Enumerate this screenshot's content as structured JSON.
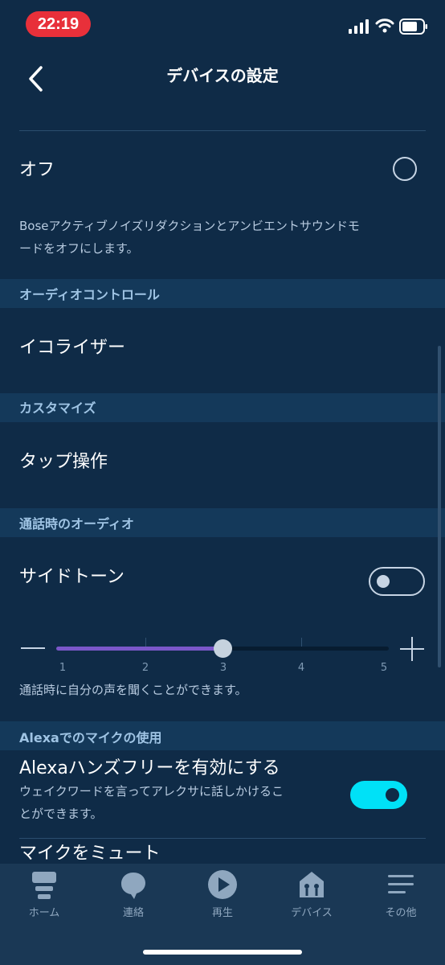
{
  "status": {
    "time": "22:19"
  },
  "nav": {
    "title": "デバイスの設定",
    "back_icon": "chevron-left-icon"
  },
  "off_option": {
    "label": "オフ",
    "description_line1": "Boseアクティブノイズリダクションとアンビエントサウンドモ",
    "description_line2": "ードをオフにします。"
  },
  "sections": {
    "audio_control": "オーディオコントロール",
    "customize": "カスタマイズ",
    "call_audio": "通話時のオーディオ",
    "alexa_mic": "Alexaでのマイクの使用"
  },
  "equalizer_label": "イコライザー",
  "tap_label": "タップ操作",
  "sidetone": {
    "label": "サイドトーン",
    "enabled": false,
    "slider_value": 3,
    "slider_min": 1,
    "slider_max": 5,
    "ticks": [
      "1",
      "2",
      "3",
      "4",
      "5"
    ],
    "description": "通話時に自分の声を聞くことができます。"
  },
  "alexa_handsfree": {
    "label": "Alexaハンズフリーを有効にする",
    "description_line1": "ウェイクワードを言ってアレクサに話しかけるこ",
    "description_line2": "とができます。",
    "enabled": true
  },
  "mute_label": "マイクをミュート",
  "tabs": [
    {
      "label": "ホーム",
      "icon": "home-icon"
    },
    {
      "label": "連絡",
      "icon": "chat-bubble-icon"
    },
    {
      "label": "再生",
      "icon": "play-icon"
    },
    {
      "label": "デバイス",
      "icon": "devices-icon"
    },
    {
      "label": "その他",
      "icon": "menu-icon"
    }
  ],
  "colors": {
    "background": "#0f2b47",
    "section": "#14395a",
    "accent_toggle": "#00e1f7",
    "slider_fill": "#7b57c9",
    "status_pill": "#e8303a"
  }
}
